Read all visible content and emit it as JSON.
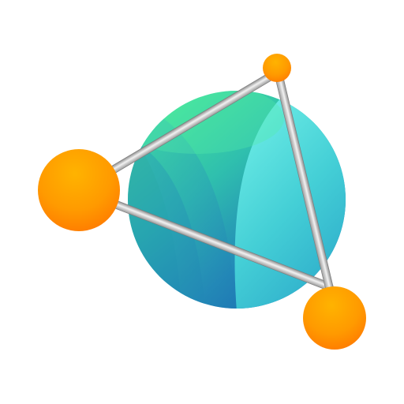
{
  "logo": {
    "icon_name": "molecule-globe-icon",
    "colors": {
      "sphere_green": "#3fe09a",
      "sphere_teal": "#2fb3c0",
      "sphere_cyan": "#5ee3e6",
      "sphere_blue": "#1d6fb4",
      "node_orange": "#ff8c00",
      "node_orange_light": "#ffb000",
      "rod_silver": "#c7c7c7"
    }
  }
}
